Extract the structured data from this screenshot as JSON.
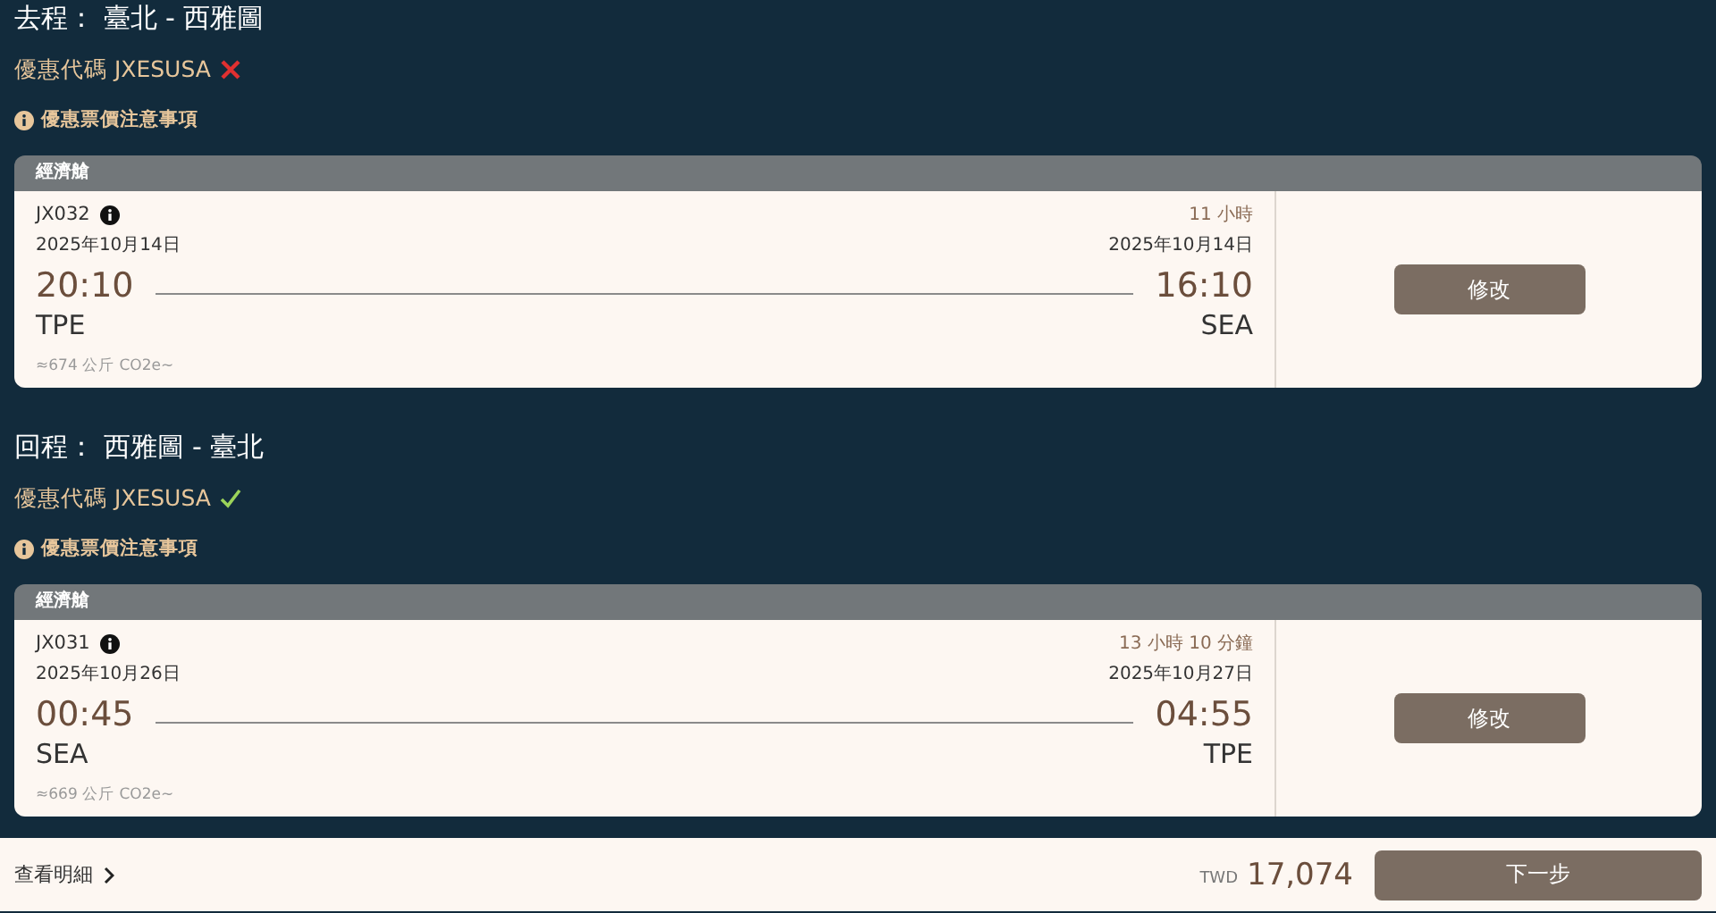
{
  "legs": [
    {
      "title": "去程： 臺北 - 西雅圖",
      "promo": {
        "label": "優惠代碼 JXESUSA",
        "valid": false
      },
      "notice": "優惠票價注意事項",
      "cabin": "經濟艙",
      "flight_no": "JX032",
      "duration": "11 小時",
      "depart": {
        "date": "2025年10月14日",
        "time": "20:10",
        "airport": "TPE"
      },
      "arrive": {
        "date": "2025年10月14日",
        "time": "16:10",
        "airport": "SEA"
      },
      "co2": "≈674 公斤 CO2e~",
      "button": "修改"
    },
    {
      "title": "回程： 西雅圖 - 臺北",
      "promo": {
        "label": "優惠代碼 JXESUSA",
        "valid": true
      },
      "notice": "優惠票價注意事項",
      "cabin": "經濟艙",
      "flight_no": "JX031",
      "duration": "13 小時 10 分鐘",
      "depart": {
        "date": "2025年10月26日",
        "time": "00:45",
        "airport": "SEA"
      },
      "arrive": {
        "date": "2025年10月27日",
        "time": "04:55",
        "airport": "TPE"
      },
      "co2": "≈669 公斤 CO2e~",
      "button": "修改"
    }
  ],
  "footer": {
    "details_link": "查看明細",
    "currency": "TWD",
    "price": "17,074",
    "next_button": "下一步"
  }
}
